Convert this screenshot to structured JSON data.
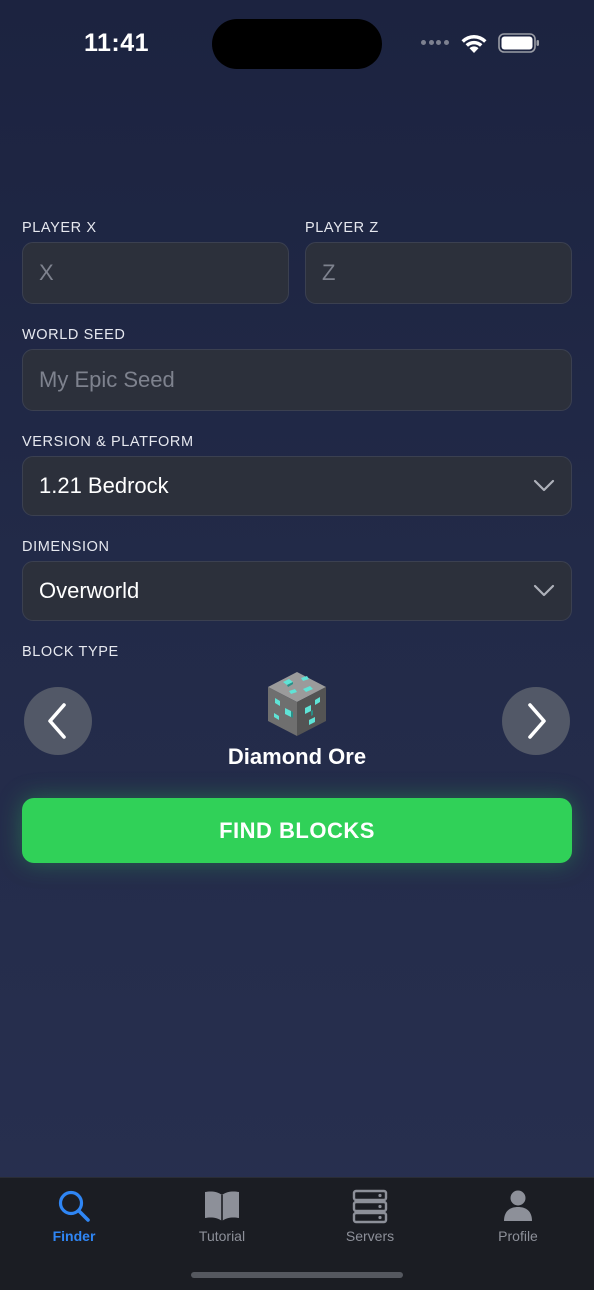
{
  "status_bar": {
    "time": "11:41"
  },
  "form": {
    "player_x": {
      "label": "PLAYER X",
      "placeholder": "X",
      "value": ""
    },
    "player_z": {
      "label": "PLAYER Z",
      "placeholder": "Z",
      "value": ""
    },
    "world_seed": {
      "label": "WORLD SEED",
      "placeholder": "My Epic Seed",
      "value": ""
    },
    "version": {
      "label": "VERSION & PLATFORM",
      "selected": "1.21 Bedrock"
    },
    "dimension": {
      "label": "DIMENSION",
      "selected": "Overworld"
    },
    "block_type": {
      "label": "BLOCK TYPE",
      "selected": "Diamond Ore",
      "icon": "diamond-ore-icon"
    }
  },
  "find_button": {
    "label": "FIND BLOCKS",
    "color": "#30d158"
  },
  "tab_bar": {
    "active_color": "#2f86f5",
    "tabs": [
      {
        "label": "Finder",
        "icon": "search-icon",
        "active": true
      },
      {
        "label": "Tutorial",
        "icon": "book-icon",
        "active": false
      },
      {
        "label": "Servers",
        "icon": "server-icon",
        "active": false
      },
      {
        "label": "Profile",
        "icon": "person-icon",
        "active": false
      }
    ]
  }
}
